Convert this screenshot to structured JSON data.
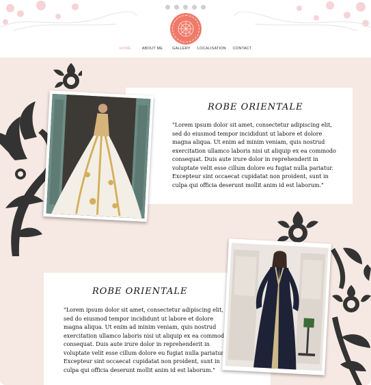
{
  "nav": {
    "items": [
      {
        "label": "HOME",
        "active": true
      },
      {
        "label": "ABOUT ME",
        "active": false
      },
      {
        "label": "GALLERY",
        "active": false
      },
      {
        "label": "LOCALISATION",
        "active": false
      },
      {
        "label": "CONTACT",
        "active": false
      }
    ]
  },
  "social_icons": [
    "twitter-icon",
    "facebook-icon",
    "tumblr-icon",
    "pinterest-icon",
    "google-plus-icon"
  ],
  "colors": {
    "accent": "#e9a3a3",
    "logo": "#f07a6a",
    "background": "#f6e8e2",
    "ornament": "#333333"
  },
  "sections": [
    {
      "title": "ROBE ORIENTALE",
      "text": "\"Lorem ipsum dolor sit amet, consectetur adipiscing elit, sed do eiusmod tempor incididunt ut labore et dolore magna aliqua. Ut enim ad minim veniam, quis nostrud exercitation ullamco laboris nisi ut aliquip ex ea commodo consequat. Duis aute irure dolor in reprehenderit in voluptate velit esse cillum dolore eu fugiat nulla pariatur. Excepteur sint occaecat cupidatat non proident, sunt in culpa qui officia deserunt mollit anim id est laborum.\""
    },
    {
      "title": "ROBE ORIENTALE",
      "text": "\"Lorem ipsum dolor sit amet, consectetur adipiscing elit, sed do eiusmod tempor incididunt ut labore et dolore magna aliqua. Ut enim ad minim veniam, quis nostrud exercitation ullamco laboris nisi ut aliquip ex ea commodo consequat. Duis aute irure dolor in reprehenderit in voluptate velit esse cillum dolore eu fugiat nulla pariatur. Excepteur sint occaecat cupidatat non proident, sunt in culpa qui officia deserunt mollit anim id est laborum.\""
    }
  ]
}
